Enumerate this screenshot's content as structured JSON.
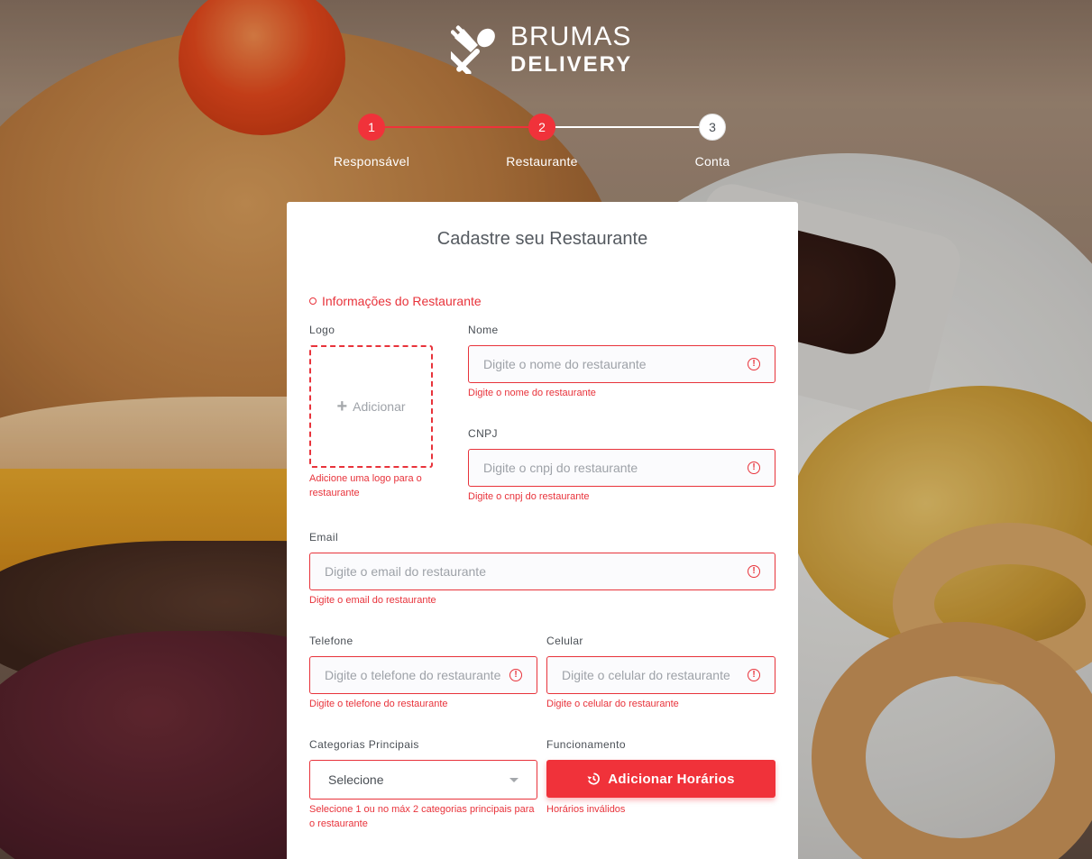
{
  "brand": {
    "line1": "BRUMAS",
    "line2": "DELIVERY"
  },
  "stepper": {
    "steps": [
      {
        "number": "1",
        "label": "Responsável",
        "state": "done"
      },
      {
        "number": "2",
        "label": "Restaurante",
        "state": "active"
      },
      {
        "number": "3",
        "label": "Conta",
        "state": "pending"
      }
    ]
  },
  "form": {
    "title": "Cadastre seu Restaurante",
    "section": "Informações do Restaurante",
    "logo": {
      "label": "Logo",
      "add_label": "Adicionar",
      "error": "Adicione uma logo para o restaurante"
    },
    "nome": {
      "label": "Nome",
      "placeholder": "Digite o nome do restaurante",
      "error": "Digite o nome do restaurante"
    },
    "cnpj": {
      "label": "CNPJ",
      "placeholder": "Digite o cnpj do restaurante",
      "error": "Digite o cnpj do restaurante"
    },
    "email": {
      "label": "Email",
      "placeholder": "Digite o email do restaurante",
      "error": "Digite o email do restaurante"
    },
    "telefone": {
      "label": "Telefone",
      "placeholder": "Digite o telefone do restaurante",
      "error": "Digite o telefone do restaurante"
    },
    "celular": {
      "label": "Celular",
      "placeholder": "Digite o celular do restaurante",
      "error": "Digite o celular do restaurante"
    },
    "categorias": {
      "label": "Categorias Principais",
      "selected": "Selecione",
      "error": "Selecione 1 ou no máx 2 categorias principais para o restaurante"
    },
    "funcionamento": {
      "label": "Funcionamento",
      "button_label": "Adicionar Horários",
      "error": "Horários inválidos"
    },
    "error_icon_glyph": "!"
  },
  "colors": {
    "accent": "#f0323a",
    "error": "#e8333b",
    "step_inactive_line": "#ffffff",
    "card_bg": "#ffffff"
  },
  "icons": {
    "brand": "fork-spoon-icon",
    "error": "alert-circle-icon",
    "add": "plus-icon",
    "dropdown": "caret-down-icon",
    "hours": "history-clock-icon"
  }
}
